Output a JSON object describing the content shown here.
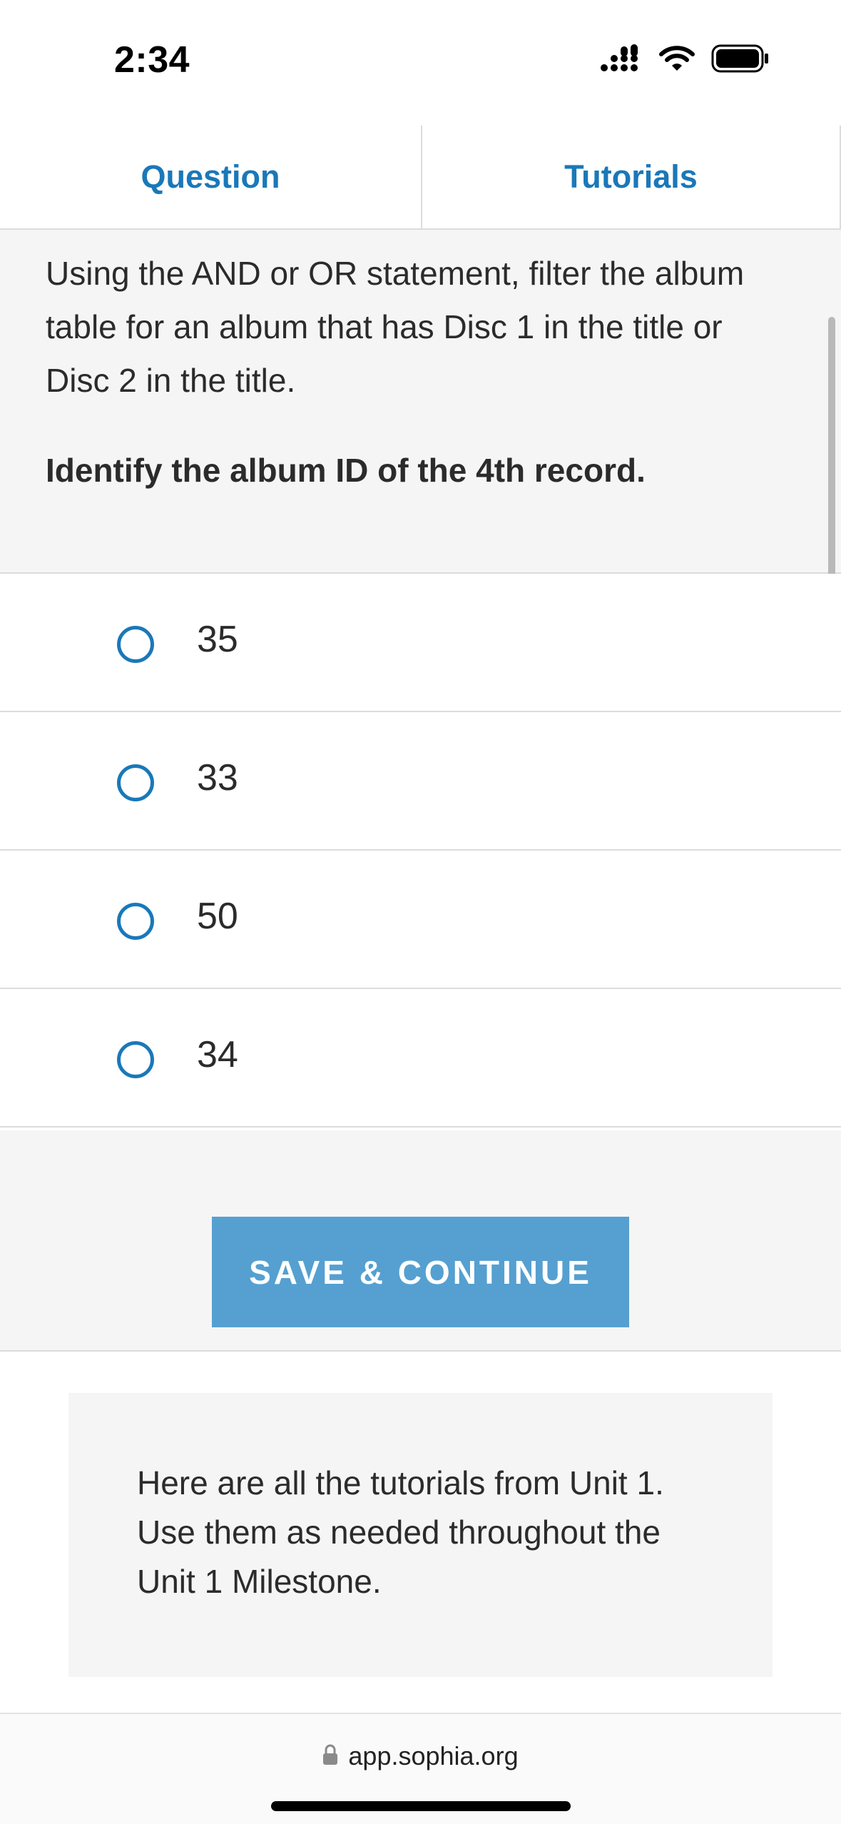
{
  "status_bar": {
    "time": "2:34"
  },
  "tabs": [
    {
      "label": "Question"
    },
    {
      "label": "Tutorials"
    }
  ],
  "question": {
    "text": "Using the AND or OR statement, filter the album table for an album that has Disc 1 in the title or Disc 2 in the title.",
    "prompt": "Identify the album ID of the 4th record."
  },
  "options": [
    {
      "label": "35"
    },
    {
      "label": "33"
    },
    {
      "label": "50"
    },
    {
      "label": "34"
    }
  ],
  "save_button": {
    "label": "SAVE & CONTINUE"
  },
  "tutorials_info": {
    "text": "Here are all the tutorials from Unit 1. Use them as needed throughout the Unit 1 Milestone."
  },
  "browser": {
    "url": "app.sophia.org"
  },
  "colors": {
    "accent": "#1a78b9",
    "button": "#55a0d1",
    "panel": "#f5f5f5"
  },
  "icons": {
    "signal": "cellular-signal-icon",
    "wifi": "wifi-icon",
    "battery": "battery-icon",
    "lock": "lock-icon"
  }
}
